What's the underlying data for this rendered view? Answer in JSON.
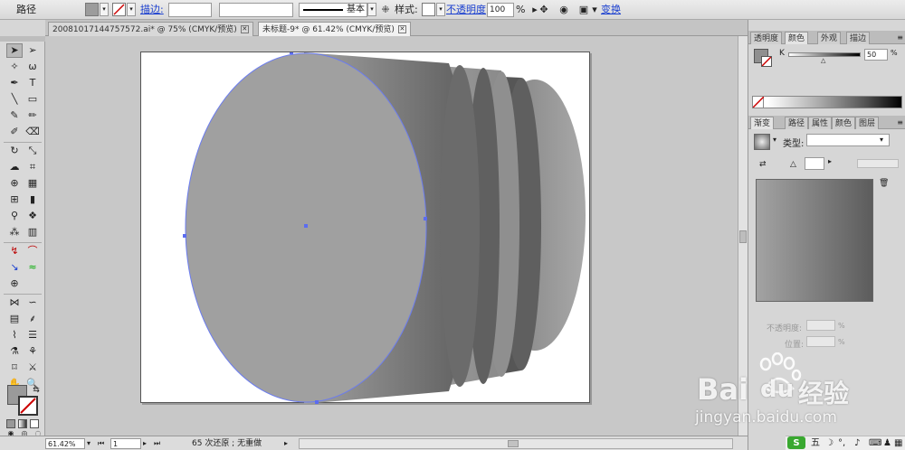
{
  "control_bar": {
    "object_type": "路径",
    "stroke_link": "描边:",
    "stroke_weight": "",
    "stroke_profile": "",
    "brush_label": "基本",
    "style_label": "样式:",
    "opacity_link": "不透明度",
    "opacity_value": "100",
    "opacity_unit": "%",
    "transform_link": "变换",
    "colors": {
      "fill": "#9c9c9c",
      "stroke_none": "#cc0000"
    }
  },
  "tabs": [
    {
      "label": "20081017144757572.ai* @ 75% (CMYK/预览)"
    },
    {
      "label": "未标题-9* @ 61.42% (CMYK/预览)"
    }
  ],
  "status": {
    "zoom": "61.42%",
    "artboard": "1",
    "message": "65 次还原 ; 无重做"
  },
  "color_panel": {
    "tabs": [
      "透明度",
      "颜色",
      "外观",
      "描边"
    ],
    "channel": "K",
    "value": "50",
    "unit": "%"
  },
  "gradient_panel": {
    "tabs": [
      "渐变",
      "路径",
      "属性",
      "颜色",
      "图层"
    ],
    "type_label": "类型:",
    "type_value": "",
    "angle_value": "",
    "opacity_label": "不透明度:",
    "location_label": "位置:",
    "opacity_unit": "%",
    "location_unit": "%"
  },
  "tray": {
    "ime": "五"
  },
  "watermark": {
    "brand_a": "Bai",
    "brand_b": "du",
    "brand_c": "经验",
    "url": "jingyan.baidu.com"
  }
}
